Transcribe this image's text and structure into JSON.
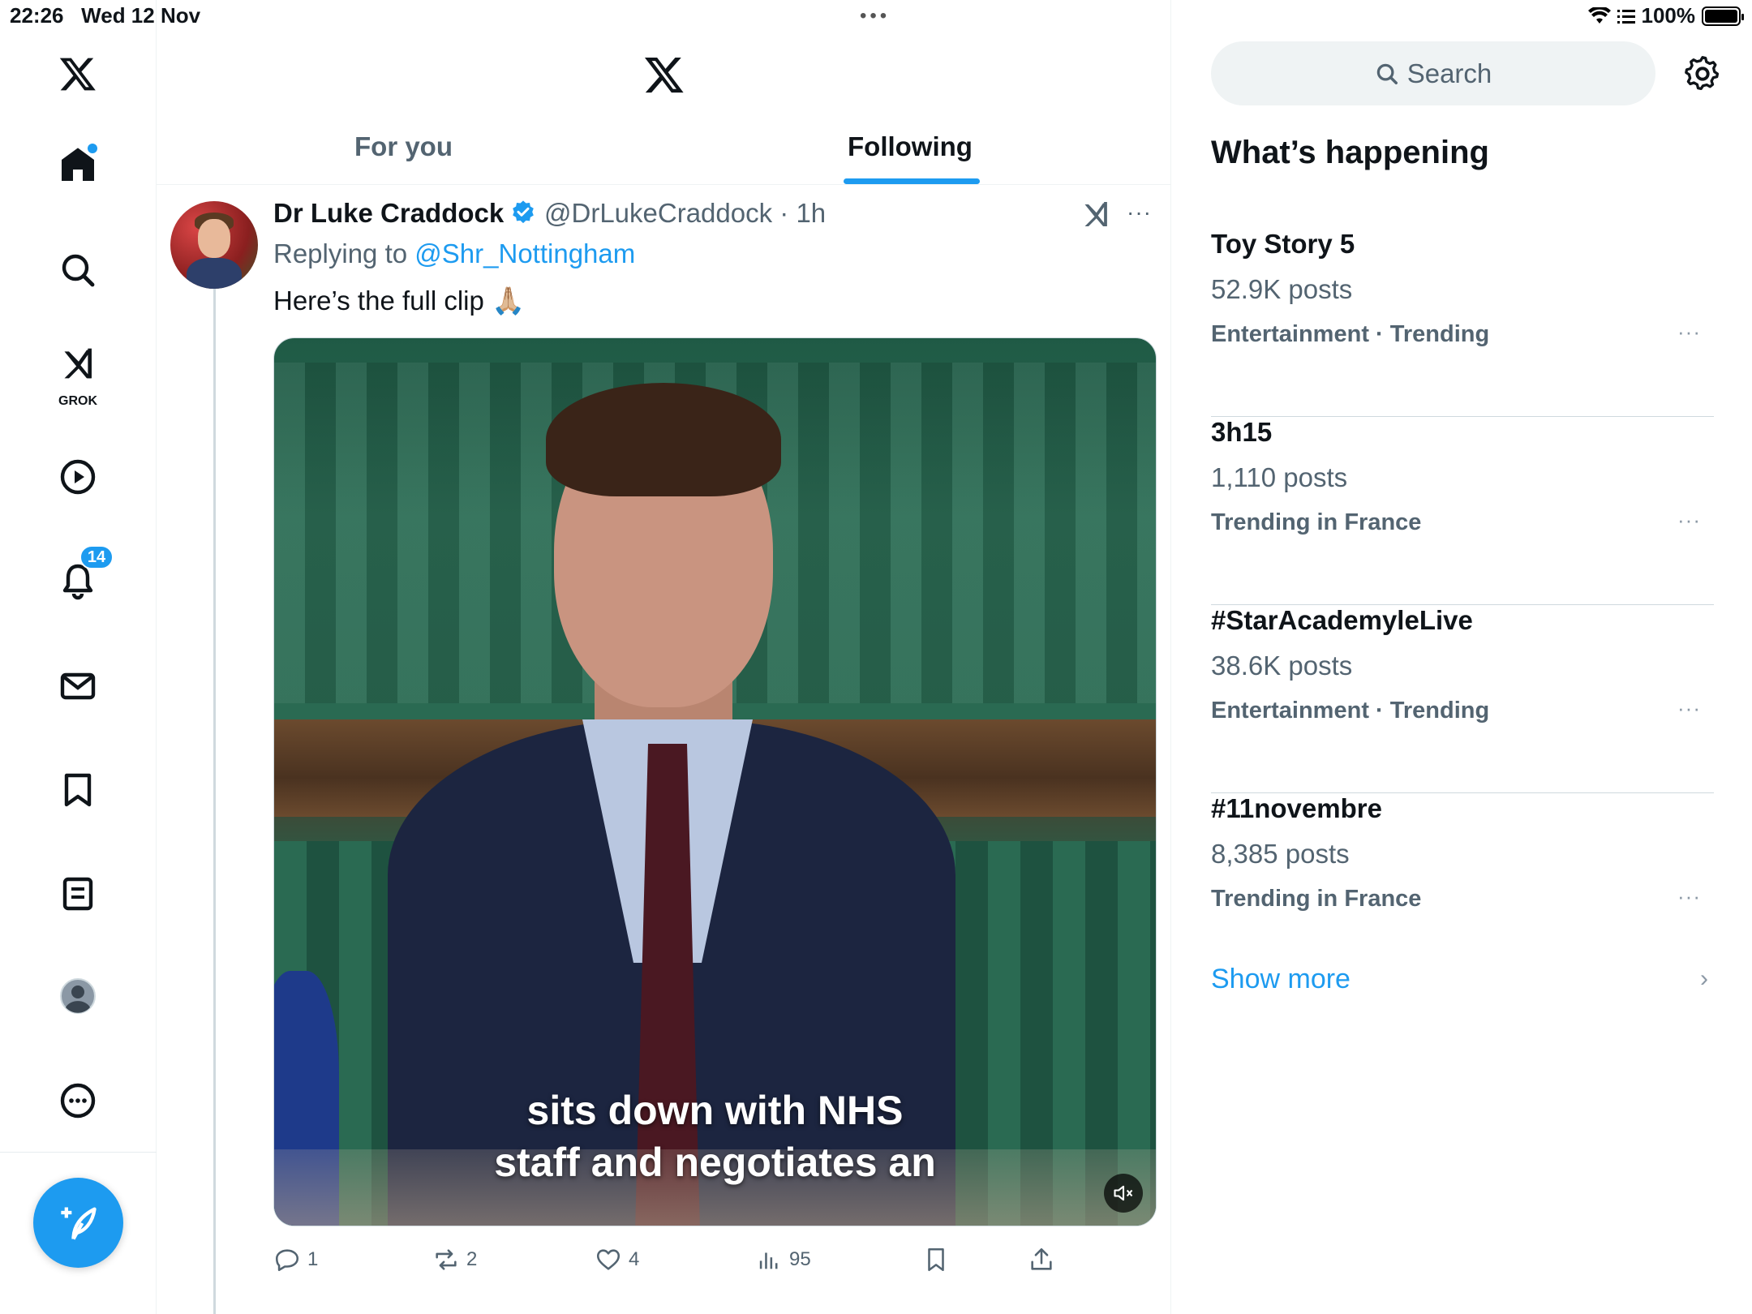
{
  "status_bar": {
    "time": "22:26",
    "date": "Wed 12 Nov",
    "battery": "100%"
  },
  "nav": {
    "grok_label": "GROK",
    "notifications_count": "14"
  },
  "tabs": {
    "for_you": "For you",
    "following": "Following"
  },
  "post": {
    "author_name": "Dr Luke Craddock",
    "handle_time": "@DrLukeCraddock · 1h",
    "replying_prefix": "Replying to",
    "reply_handle": "@Shr_Nottingham",
    "text": "Here’s the full clip 🙏🏼",
    "video_caption_line1": "sits down with NHS",
    "video_caption_line2": "staff and negotiates an",
    "more": "···",
    "replies": "1",
    "reposts": "2",
    "likes": "4",
    "views": "95"
  },
  "sidebar": {
    "search_placeholder": "Search",
    "heading": "What’s happening",
    "trends": [
      {
        "title": "Toy Story 5",
        "count": "52.9K posts",
        "category": "Entertainment · Trending"
      },
      {
        "title": "3h15",
        "count": "1,110 posts",
        "category": "Trending in France"
      },
      {
        "title": "#StarAcademyleLive",
        "count": "38.6K posts",
        "category": "Entertainment · Trending"
      },
      {
        "title": "#11novembre",
        "count": "8,385 posts",
        "category": "Trending in France"
      }
    ],
    "trend_more": "···",
    "show_more": "Show more"
  },
  "colors": {
    "accent": "#1d9bf0",
    "text": "#0f1419",
    "muted": "#536471"
  }
}
